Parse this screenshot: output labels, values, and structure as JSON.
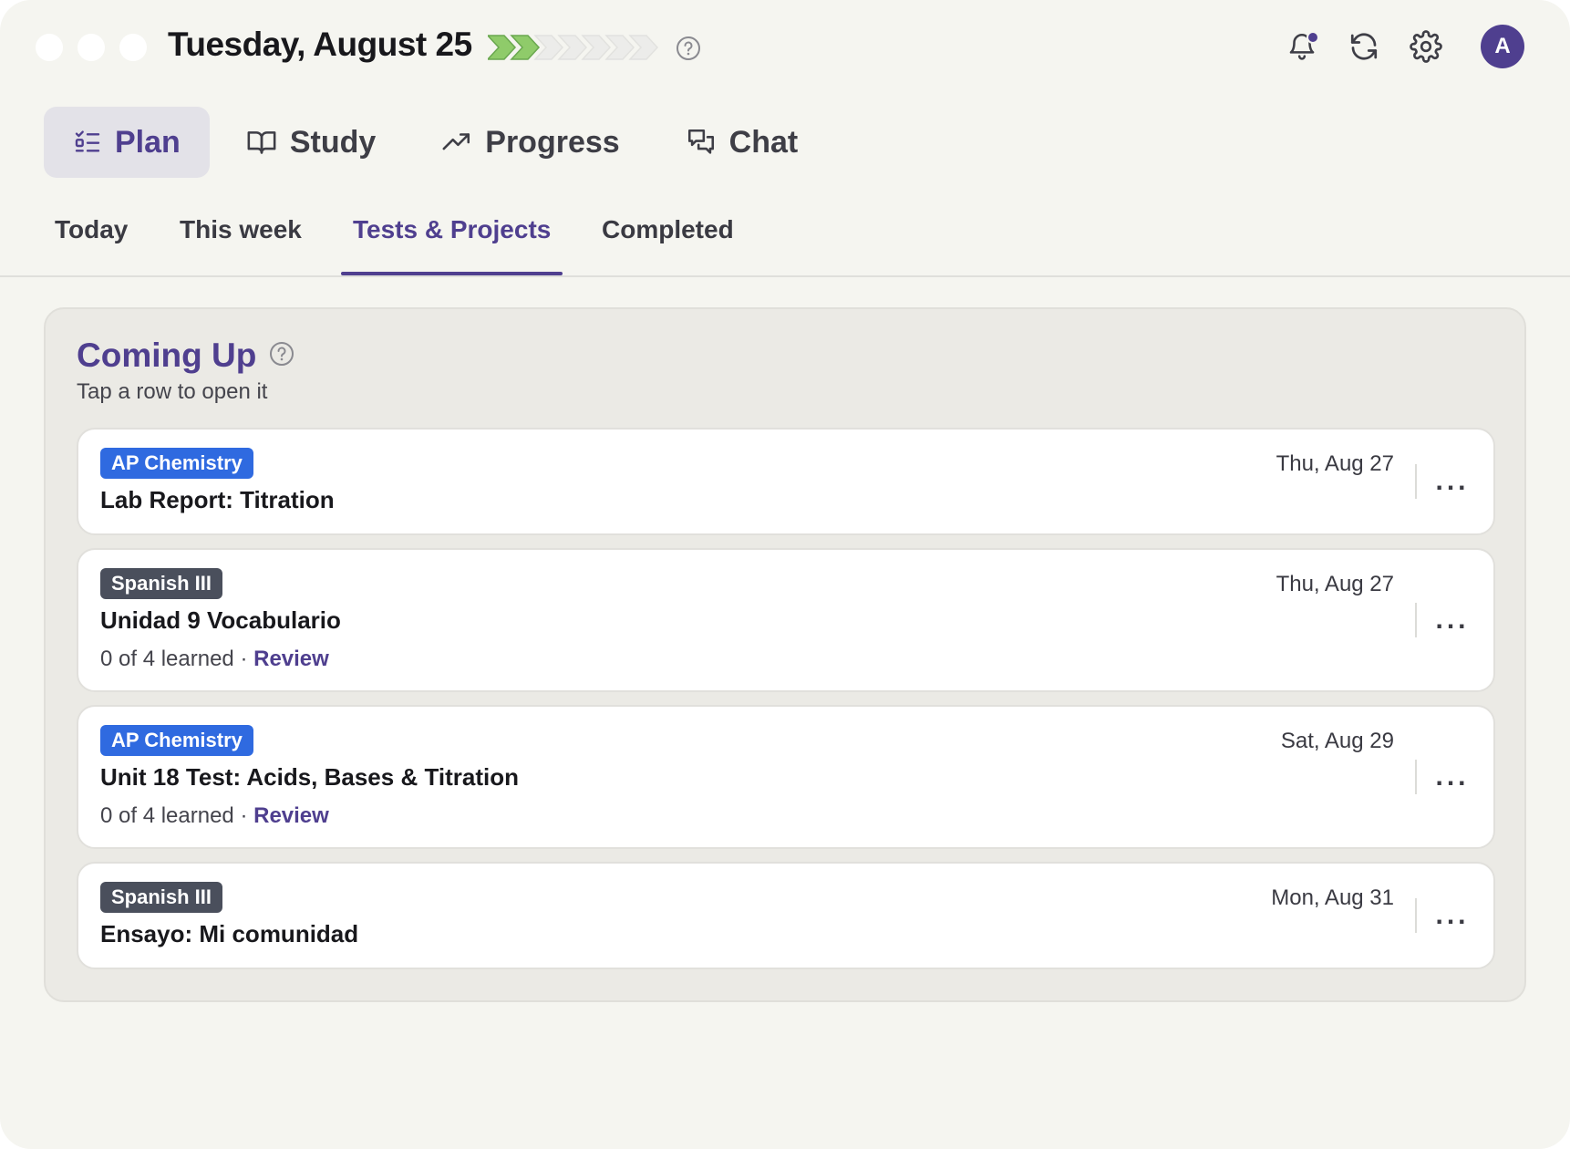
{
  "header": {
    "date": "Tuesday, August 25",
    "streak": {
      "total": 7,
      "completed": 2,
      "completed_color": "#8fcb6a",
      "empty_color": "#ececea"
    },
    "help_icon": "question-circle-icon",
    "icons": [
      "bell-icon",
      "refresh-icon",
      "gear-icon"
    ],
    "notification_dot_color": "#4f3f8f",
    "avatar_initial": "A"
  },
  "nav": {
    "items": [
      {
        "label": "Plan",
        "icon": "checklist-icon",
        "active": true
      },
      {
        "label": "Study",
        "icon": "book-icon",
        "active": false
      },
      {
        "label": "Progress",
        "icon": "trending-up-icon",
        "active": false
      },
      {
        "label": "Chat",
        "icon": "chat-bubbles-icon",
        "active": false
      }
    ]
  },
  "sub_tabs": {
    "items": [
      {
        "label": "Today",
        "active": false
      },
      {
        "label": "This week",
        "active": false
      },
      {
        "label": "Tests & Projects",
        "active": true
      },
      {
        "label": "Completed",
        "active": false
      }
    ]
  },
  "panel": {
    "title": "Coming Up",
    "subtitle": "Tap a row to open it",
    "cards": [
      {
        "course": "AP Chemistry",
        "title": "Lab Report: Titration",
        "date": "Thu, Aug 27",
        "progress": "",
        "review": ""
      },
      {
        "course": "Spanish III",
        "title": "Unidad 9 Vocabulario",
        "date": "Thu, Aug 27",
        "progress": "0 of 4 learned",
        "separator": " · ",
        "review": "Review"
      },
      {
        "course": "AP Chemistry",
        "title": "Unit 18 Test: Acids, Bases & Titration",
        "date": "Sat, Aug 29",
        "progress": "0 of 4 learned",
        "separator": " · ",
        "review": "Review"
      },
      {
        "course": "Spanish III",
        "title": "Ensayo: Mi comunidad",
        "date": "Mon, Aug 31",
        "progress": "",
        "review": ""
      }
    ],
    "more_label": "..."
  },
  "colors": {
    "accent": "#4f3f8f",
    "chemistry_badge": "#2f6ae0",
    "spanish_badge": "#4a4f5c",
    "background": "#f5f5f0"
  }
}
